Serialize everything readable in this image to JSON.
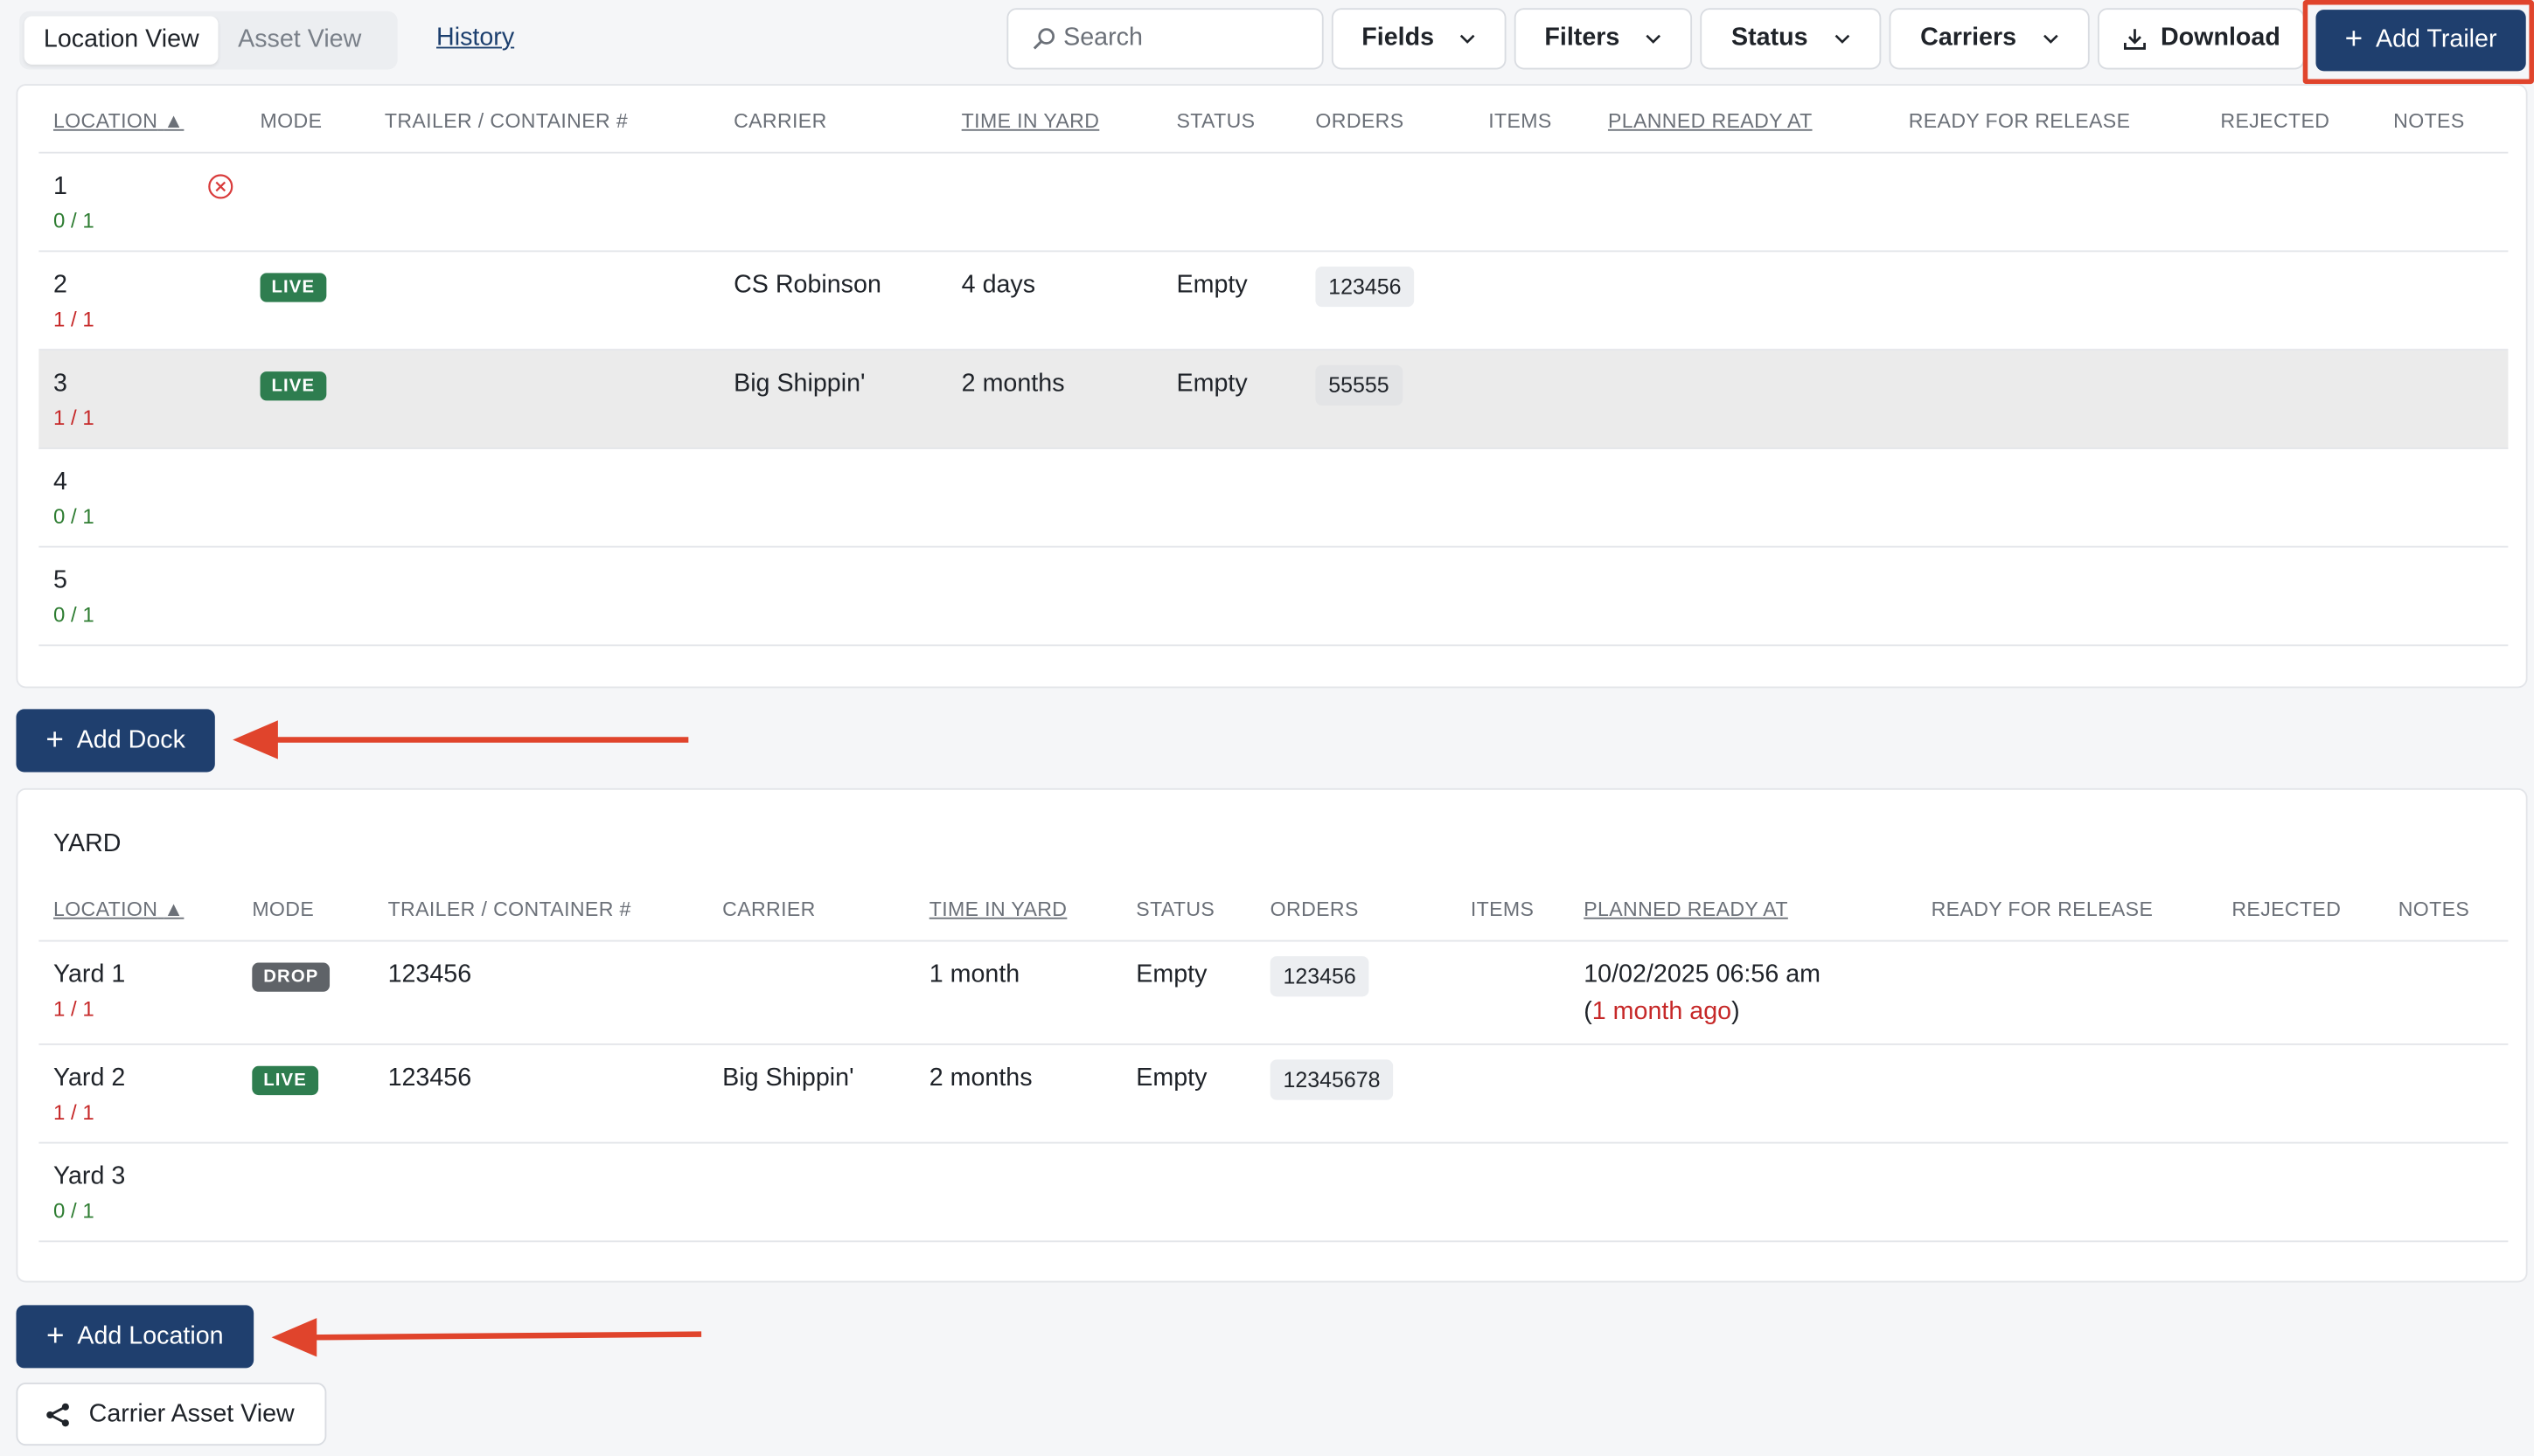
{
  "toolbar": {
    "tabs": [
      {
        "label": "Location View",
        "active": true
      },
      {
        "label": "Asset View",
        "active": false
      }
    ],
    "history_label": "History",
    "search_placeholder": "Search",
    "fields_label": "Fields",
    "filters_label": "Filters",
    "status_label": "Status",
    "carriers_label": "Carriers",
    "download_label": "Download",
    "add_trailer_label": "Add Trailer"
  },
  "columns_docks": [
    "LOCATION",
    "MODE",
    "TRAILER / CONTAINER #",
    "CARRIER",
    "TIME IN YARD",
    "STATUS",
    "ORDERS",
    "ITEMS",
    "PLANNED READY AT",
    "READY FOR RELEASE",
    "REJECTED",
    "NOTES"
  ],
  "docks": [
    {
      "location": "1",
      "count": "0 / 1",
      "mode": "",
      "trailer": "",
      "carrier": "",
      "time": "",
      "status": "",
      "orders": ""
    },
    {
      "location": "2",
      "count": "1 / 1",
      "mode": "LIVE",
      "trailer": "",
      "carrier": "CS Robinson",
      "time": "4 days",
      "status": "Empty",
      "orders": "123456"
    },
    {
      "location": "3",
      "count": "1 / 1",
      "mode": "LIVE",
      "trailer": "",
      "carrier": "Big Shippin'",
      "time": "2 months",
      "status": "Empty",
      "orders": "55555"
    },
    {
      "location": "4",
      "count": "0 / 1",
      "mode": "",
      "trailer": "",
      "carrier": "",
      "time": "",
      "status": "",
      "orders": ""
    },
    {
      "location": "5",
      "count": "0 / 1",
      "mode": "",
      "trailer": "",
      "carrier": "",
      "time": "",
      "status": "",
      "orders": ""
    }
  ],
  "add_dock_label": "Add Dock",
  "yard": {
    "title": "YARD",
    "columns": [
      "LOCATION",
      "MODE",
      "TRAILER / CONTAINER #",
      "CARRIER",
      "TIME IN YARD",
      "STATUS",
      "ORDERS",
      "ITEMS",
      "PLANNED READY AT",
      "READY FOR RELEASE",
      "REJECTED",
      "NOTES"
    ],
    "rows": [
      {
        "location": "Yard 1",
        "count": "1 / 1",
        "mode": "DROP",
        "trailer": "123456",
        "carrier": "",
        "time": "1 month",
        "status": "Empty",
        "orders": "123456",
        "planned": "10/02/2025 06:56 am",
        "planned_rel": "1 month ago"
      },
      {
        "location": "Yard 2",
        "count": "1 / 1",
        "mode": "LIVE",
        "trailer": "123456",
        "carrier": "Big Shippin'",
        "time": "2 months",
        "status": "Empty",
        "orders": "12345678",
        "planned": "",
        "planned_rel": ""
      },
      {
        "location": "Yard 3",
        "count": "0 / 1",
        "mode": "",
        "trailer": "",
        "carrier": "",
        "time": "",
        "status": "",
        "orders": "",
        "planned": "",
        "planned_rel": ""
      }
    ]
  },
  "add_location_label": "Add Location",
  "carrier_asset_view_label": "Carrier Asset View",
  "colors": {
    "primary": "#1f3f6e",
    "live": "#2e7d4f",
    "drop": "#5f6368",
    "annotation_red": "#e0442c",
    "count_ok": "#2e7d32",
    "count_full": "#c62828"
  }
}
